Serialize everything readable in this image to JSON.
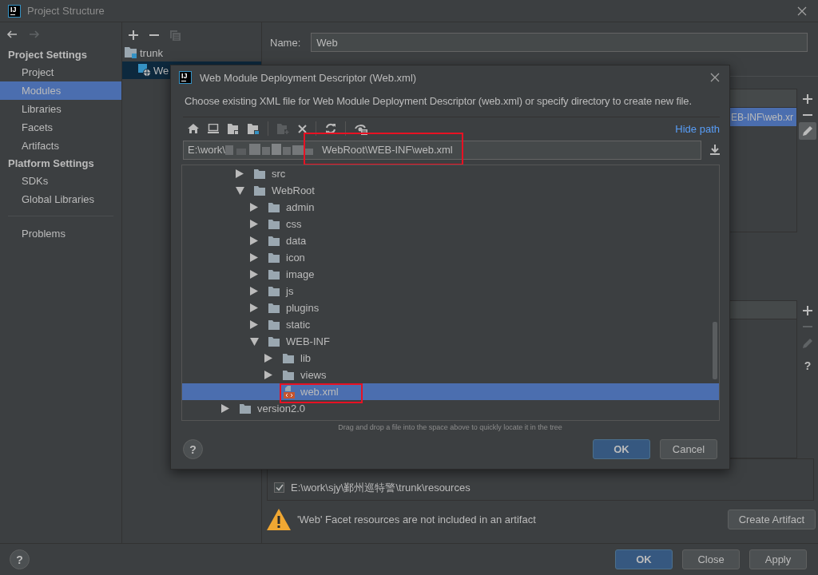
{
  "window": {
    "logo": "IJ",
    "title": "Project Structure"
  },
  "sidebar": {
    "sections": [
      {
        "title": "Project Settings",
        "items": [
          {
            "label": "Project",
            "selected": false
          },
          {
            "label": "Modules",
            "selected": true
          },
          {
            "label": "Libraries",
            "selected": false
          },
          {
            "label": "Facets",
            "selected": false
          },
          {
            "label": "Artifacts",
            "selected": false
          }
        ]
      },
      {
        "title": "Platform Settings",
        "items": [
          {
            "label": "SDKs",
            "selected": false
          },
          {
            "label": "Global Libraries",
            "selected": false
          }
        ]
      }
    ],
    "extra_items": [
      {
        "label": "Problems",
        "selected": false
      }
    ]
  },
  "modules": [
    {
      "label": "trunk",
      "kind": "project",
      "selected": false,
      "children": [
        {
          "label": "We",
          "kind": "web",
          "selected": true
        }
      ]
    }
  ],
  "name_field": {
    "label": "Name:",
    "value": "Web"
  },
  "descriptors_table": {
    "visible_cell": "EB-INF\\web.xr",
    "selected": true
  },
  "roots_help": "?",
  "source_roots": [
    {
      "path": "E:\\work\\sjy\\鄞州巡特警\\trunk\\resources",
      "checked": true
    }
  ],
  "warning": {
    "text": "'Web' Facet resources are not included in an artifact",
    "button": "Create Artifact"
  },
  "help": "?",
  "footer_buttons": [
    {
      "label": "OK",
      "kind": "default"
    },
    {
      "label": "Close",
      "kind": "normal"
    },
    {
      "label": "Apply",
      "kind": "normal"
    }
  ],
  "dialog": {
    "logo": "IJ",
    "title": "Web Module Deployment Descriptor (Web.xml)",
    "description": "Choose existing XML file for Web Module Deployment Descriptor (web.xml) or specify directory to create new file.",
    "hide_path": "Hide path",
    "path_start": "E:\\work\\",
    "path_end": "WebRoot\\WEB-INF\\web.xml",
    "path_highlighted": true,
    "tree": [
      {
        "children": [
          {
            "label": "src",
            "kind": "folder",
            "expanded": false,
            "selected": false
          },
          {
            "label": "WebRoot",
            "kind": "folder",
            "expanded": true,
            "selected": false,
            "children": [
              {
                "label": "admin",
                "kind": "folder",
                "expanded": false,
                "selected": false
              },
              {
                "label": "css",
                "kind": "folder",
                "expanded": false,
                "selected": false
              },
              {
                "label": "data",
                "kind": "folder",
                "expanded": false,
                "selected": false
              },
              {
                "label": "icon",
                "kind": "folder",
                "expanded": false,
                "selected": false
              },
              {
                "label": "image",
                "kind": "folder",
                "expanded": false,
                "selected": false
              },
              {
                "label": "js",
                "kind": "folder",
                "expanded": false,
                "selected": false
              },
              {
                "label": "plugins",
                "kind": "folder",
                "expanded": false,
                "selected": false
              },
              {
                "label": "static",
                "kind": "folder",
                "expanded": false,
                "selected": false
              },
              {
                "label": "WEB-INF",
                "kind": "folder",
                "expanded": true,
                "selected": false,
                "children": [
                  {
                    "label": "lib",
                    "kind": "folder",
                    "expanded": false,
                    "selected": false
                  },
                  {
                    "label": "views",
                    "kind": "folder",
                    "expanded": false,
                    "selected": false
                  },
                  {
                    "label": "web.xml",
                    "kind": "file",
                    "selected": true,
                    "highlighted": true
                  }
                ]
              }
            ]
          }
        ]
      },
      {
        "label": "version2.0",
        "kind": "folder",
        "expanded": false,
        "selected": false
      }
    ],
    "hint": "Drag and drop a file into the space above to quickly locate it in the tree",
    "help": "?",
    "buttons": [
      {
        "label": "OK",
        "kind": "default"
      },
      {
        "label": "Cancel",
        "kind": "normal"
      }
    ]
  }
}
